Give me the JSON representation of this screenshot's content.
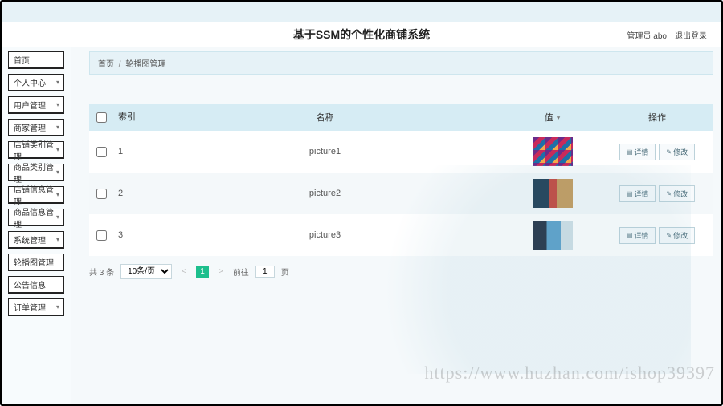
{
  "header": {
    "title": "基于SSM的个性化商铺系统",
    "admin_label": "管理员 abo",
    "logout_label": "退出登录"
  },
  "sidebar": {
    "items": [
      {
        "label": "首页",
        "has_caret": false
      },
      {
        "label": "个人中心",
        "has_caret": true
      },
      {
        "label": "用户管理",
        "has_caret": true
      },
      {
        "label": "商家管理",
        "has_caret": true
      },
      {
        "label": "店铺类别管理",
        "has_caret": true
      },
      {
        "label": "商品类别管理",
        "has_caret": true
      },
      {
        "label": "店铺信息管理",
        "has_caret": true
      },
      {
        "label": "商品信息管理",
        "has_caret": true
      },
      {
        "label": "系统管理",
        "has_caret": true
      },
      {
        "label": "轮播图管理",
        "has_caret": false
      },
      {
        "label": "公告信息",
        "has_caret": false
      },
      {
        "label": "订单管理",
        "has_caret": true
      }
    ]
  },
  "breadcrumb": {
    "home": "首页",
    "current": "轮播图管理"
  },
  "table": {
    "headers": {
      "index": "索引",
      "name": "名称",
      "value": "值",
      "action": "操作"
    },
    "rows": [
      {
        "idx": "1",
        "name": "picture1"
      },
      {
        "idx": "2",
        "name": "picture2"
      },
      {
        "idx": "3",
        "name": "picture3"
      }
    ],
    "actions": {
      "detail": "详情",
      "edit": "修改"
    }
  },
  "pager": {
    "total": "共 3 条",
    "per_page": "10条/页",
    "prev": "<",
    "current": "1",
    "next": ">",
    "goto": "前往",
    "goto_val": "1",
    "page_suffix": "页"
  },
  "watermark": "https://www.huzhan.com/ishop39397"
}
